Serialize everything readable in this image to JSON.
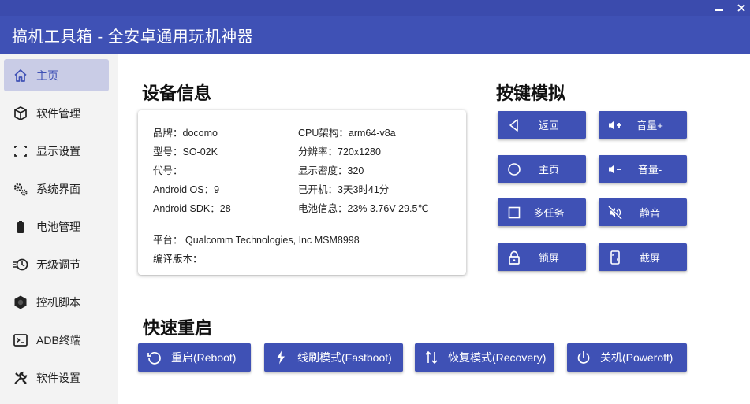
{
  "window": {
    "title": "搞机工具箱 - 全安卓通用玩机神器"
  },
  "sidebar": {
    "items": [
      {
        "label": "主页",
        "icon": "home-icon",
        "active": true
      },
      {
        "label": "软件管理",
        "icon": "cube-icon",
        "active": false
      },
      {
        "label": "显示设置",
        "icon": "display-icon",
        "active": false
      },
      {
        "label": "系统界面",
        "icon": "gears-icon",
        "active": false
      },
      {
        "label": "电池管理",
        "icon": "battery-icon",
        "active": false
      },
      {
        "label": "无级调节",
        "icon": "clock-icon",
        "active": false
      },
      {
        "label": "控机脚本",
        "icon": "hexagon-icon",
        "active": false
      },
      {
        "label": "ADB终端",
        "icon": "terminal-icon",
        "active": false
      },
      {
        "label": "软件设置",
        "icon": "tools-icon",
        "active": false
      }
    ]
  },
  "device_info": {
    "title": "设备信息",
    "brand": "品牌：docomo",
    "model": "型号：SO-02K",
    "codename": "代号：",
    "android_os": "Android OS：9",
    "android_sdk": "Android SDK：28",
    "cpu_arch": "CPU架构：arm64-v8a",
    "resolution": "分辨率：720x1280",
    "density": "显示密度：320",
    "uptime": "已开机：3天3时41分",
    "battery": "电池信息：23%  3.76V  29.5℃",
    "platform": "平台：  Qualcomm Technologies, Inc MSM8998",
    "build": "编译版本："
  },
  "key_sim": {
    "title": "按键模拟",
    "buttons": [
      {
        "label": "返回",
        "icon": "back-icon"
      },
      {
        "label": "音量+",
        "icon": "volume-up-icon"
      },
      {
        "label": "主页",
        "icon": "home-circle-icon"
      },
      {
        "label": "音量-",
        "icon": "volume-down-icon"
      },
      {
        "label": "多任务",
        "icon": "recents-icon"
      },
      {
        "label": "静音",
        "icon": "mute-icon"
      },
      {
        "label": "锁屏",
        "icon": "lock-icon"
      },
      {
        "label": "截屏",
        "icon": "screenshot-icon"
      }
    ]
  },
  "quick_reboot": {
    "title": "快速重启",
    "buttons": [
      {
        "label": "重启(Reboot)",
        "icon": "restart-icon"
      },
      {
        "label": "线刷模式(Fastboot)",
        "icon": "bolt-icon"
      },
      {
        "label": "恢复模式(Recovery)",
        "icon": "updown-arrows-icon"
      },
      {
        "label": "关机(Poweroff)",
        "icon": "power-icon"
      }
    ]
  },
  "colors": {
    "accent": "#3f51b5",
    "titlebar": "#3b4bad",
    "active_nav_bg": "#c9cce6"
  }
}
